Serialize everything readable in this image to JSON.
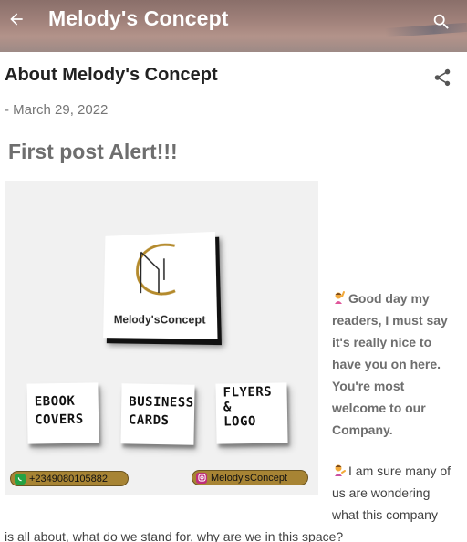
{
  "header": {
    "back_icon": "arrow-back-icon",
    "title": "Melody's Concept",
    "search_icon": "search-icon"
  },
  "post": {
    "title": "About Melody's Concept",
    "share_icon": "share-icon",
    "date": "- March 29, 2022",
    "heading": "First post Alert!!!"
  },
  "promo": {
    "logo_text": "Melody'sConcept",
    "cards": {
      "ebook": [
        "EBOOK",
        "COVERS"
      ],
      "business": [
        "BUSINESS",
        "CARDS"
      ],
      "flyers": [
        "FLYERS",
        "&",
        "LOGO"
      ]
    },
    "whatsapp": "+2349080105882",
    "instagram": "Melody'sConcept",
    "colors": {
      "gold": "#a78434",
      "whatsapp": "#25a244",
      "instagram": "#c02e7a"
    }
  },
  "body": {
    "greeting_emoji": "person-raising-hand-emoji",
    "greeting": "Good day my readers, I must say it's really nice to have you on here. You're most welcome to our Company.",
    "wonder_emoji": "person-tipping-hand-emoji",
    "wonder": "I am sure many of us are wondering what this company",
    "continuation": "is all about, what do we stand for, why are we in this space?"
  }
}
